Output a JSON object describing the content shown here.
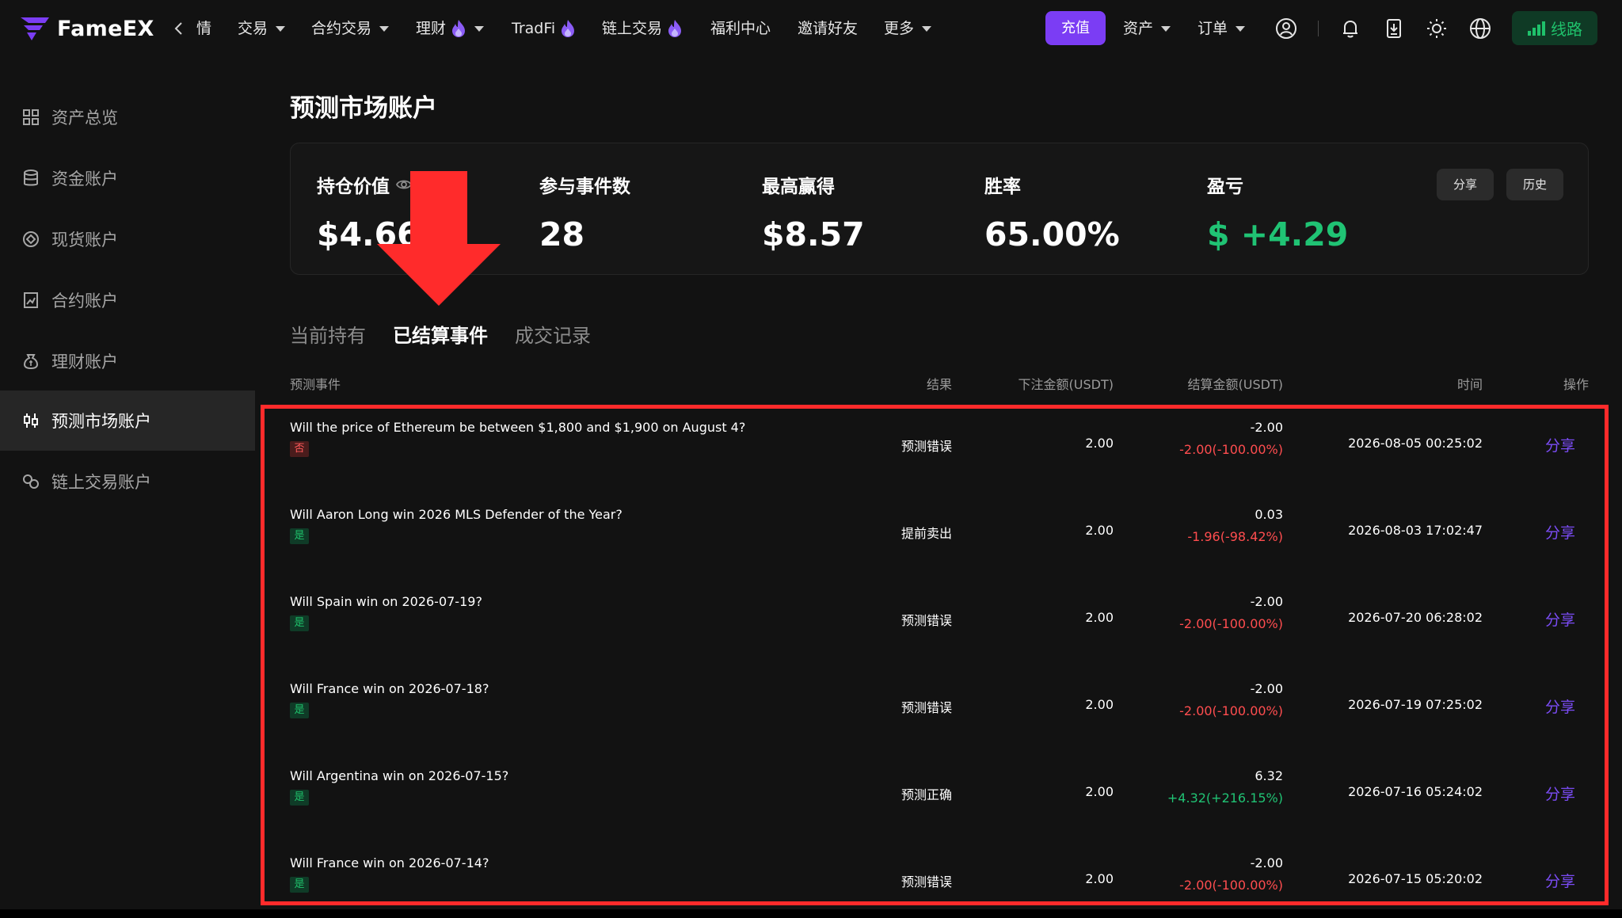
{
  "brand": {
    "name": "FameEX",
    "accent": "#7b3df4"
  },
  "topnav": {
    "back_label": "情",
    "items": [
      {
        "label": "交易",
        "caret": true,
        "fire": false
      },
      {
        "label": "合约交易",
        "caret": true,
        "fire": false
      },
      {
        "label": "理财",
        "caret": true,
        "fire": true
      },
      {
        "label": "TradFi",
        "caret": false,
        "fire": true
      },
      {
        "label": "链上交易",
        "caret": false,
        "fire": true
      },
      {
        "label": "福利中心",
        "caret": false,
        "fire": false
      },
      {
        "label": "邀请好友",
        "caret": false,
        "fire": false
      },
      {
        "label": "更多",
        "caret": true,
        "fire": false
      }
    ],
    "deposit_label": "充值",
    "assets_label": "资产",
    "orders_label": "订单",
    "route_label": "线路",
    "icons": [
      "user-icon",
      "bell-icon",
      "download-icon",
      "sun-icon",
      "globe-icon"
    ]
  },
  "sidebar": {
    "items": [
      {
        "label": "资产总览",
        "icon": "grid-icon",
        "active": false
      },
      {
        "label": "资金账户",
        "icon": "database-icon",
        "active": false
      },
      {
        "label": "现货账户",
        "icon": "spot-icon",
        "active": false
      },
      {
        "label": "合约账户",
        "icon": "contract-icon",
        "active": false
      },
      {
        "label": "理财账户",
        "icon": "wealth-icon",
        "active": false
      },
      {
        "label": "预测市场账户",
        "icon": "prediction-icon",
        "active": true
      },
      {
        "label": "链上交易账户",
        "icon": "onchain-icon",
        "active": false
      }
    ]
  },
  "main": {
    "title": "预测市场账户",
    "stats": {
      "position_value_label": "持仓价值",
      "position_value": "$4.66",
      "events_label": "参与事件数",
      "events": "28",
      "max_win_label": "最高赢得",
      "max_win": "$8.57",
      "win_rate_label": "胜率",
      "win_rate": "65.00%",
      "pnl_label": "盈亏",
      "pnl": "$ +4.29",
      "share_label": "分享",
      "history_label": "历史"
    },
    "tabs": [
      {
        "label": "当前持有",
        "active": false
      },
      {
        "label": "已结算事件",
        "active": true
      },
      {
        "label": "成交记录",
        "active": false
      }
    ],
    "table": {
      "headers": {
        "event": "预测事件",
        "result": "结果",
        "bet": "下注金额(USDT)",
        "settle": "结算金额(USDT)",
        "time": "时间",
        "action": "操作"
      },
      "rows": [
        {
          "event": "Will the price of Ethereum be between $1,800 and $1,900 on August 4?",
          "tag": "否",
          "tag_type": "no",
          "result": "预测错误",
          "bet": "2.00",
          "settle": "-2.00",
          "pnl": "-2.00(-100.00%)",
          "pnl_type": "neg",
          "time": "2026-08-05 00:25:02",
          "action": "分享"
        },
        {
          "event": "Will Aaron Long win 2026 MLS Defender of the Year?",
          "tag": "是",
          "tag_type": "yes",
          "result": "提前卖出",
          "bet": "2.00",
          "settle": "0.03",
          "pnl": "-1.96(-98.42%)",
          "pnl_type": "neg",
          "time": "2026-08-03 17:02:47",
          "action": "分享"
        },
        {
          "event": "Will Spain win on 2026-07-19?",
          "tag": "是",
          "tag_type": "yes",
          "result": "预测错误",
          "bet": "2.00",
          "settle": "-2.00",
          "pnl": "-2.00(-100.00%)",
          "pnl_type": "neg",
          "time": "2026-07-20 06:28:02",
          "action": "分享"
        },
        {
          "event": "Will France win on 2026-07-18?",
          "tag": "是",
          "tag_type": "yes",
          "result": "预测错误",
          "bet": "2.00",
          "settle": "-2.00",
          "pnl": "-2.00(-100.00%)",
          "pnl_type": "neg",
          "time": "2026-07-19 07:25:02",
          "action": "分享"
        },
        {
          "event": "Will Argentina win on 2026-07-15?",
          "tag": "是",
          "tag_type": "yes",
          "result": "预测正确",
          "bet": "2.00",
          "settle": "6.32",
          "pnl": "+4.32(+216.15%)",
          "pnl_type": "pos",
          "time": "2026-07-16 05:24:02",
          "action": "分享"
        },
        {
          "event": "Will France win on 2026-07-14?",
          "tag": "是",
          "tag_type": "yes",
          "result": "预测错误",
          "bet": "2.00",
          "settle": "-2.00",
          "pnl": "-2.00(-100.00%)",
          "pnl_type": "neg",
          "time": "2026-07-15 05:20:02",
          "action": "分享"
        }
      ]
    }
  },
  "colors": {
    "background": "#121212",
    "positive": "#20c374",
    "negative": "#ff4d4f",
    "link": "#7b4cf5",
    "annotation": "#ff2b2b"
  }
}
